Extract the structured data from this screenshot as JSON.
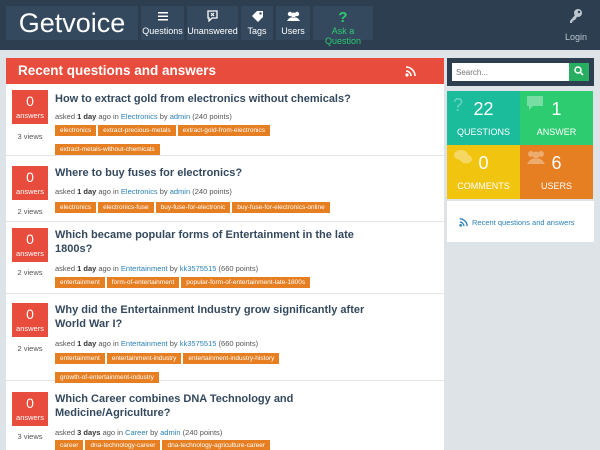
{
  "header": {
    "logo": "Getvoice",
    "nav": [
      {
        "label": "Questions",
        "icon": "list-icon"
      },
      {
        "label": "Unanswered",
        "icon": "unanswered-icon"
      },
      {
        "label": "Tags",
        "icon": "tag-icon"
      },
      {
        "label": "Users",
        "icon": "users-icon"
      },
      {
        "label": "Ask a Question",
        "icon": "question-mark-icon"
      }
    ],
    "login_label": "Login"
  },
  "main": {
    "title": "Recent questions and answers",
    "answers_label": "answers",
    "questions": [
      {
        "answers": "0",
        "views": "3 views",
        "title": "How to extract gold from electronics without chemicals?",
        "asked": "asked",
        "when": "1 day",
        "ago": "ago in",
        "category": "Electronics",
        "by": "by",
        "user": "admin",
        "points": "(240 points)",
        "tags": [
          "electronics",
          "extract-precious-metals",
          "extract-gold-from-electronics",
          "extract-metals-without-chemicals"
        ]
      },
      {
        "answers": "0",
        "views": "2 views",
        "title": "Where to buy fuses for electronics?",
        "asked": "asked",
        "when": "1 day",
        "ago": "ago in",
        "category": "Electronics",
        "by": "by",
        "user": "admin",
        "points": "(240 points)",
        "tags": [
          "electronics",
          "electronics-fuse",
          "buy-fuse-for-electronic",
          "buy-fuse-for-electronics-online"
        ]
      },
      {
        "answers": "0",
        "views": "2 views",
        "title": "Which became popular forms of Entertainment in the late 1800s?",
        "asked": "asked",
        "when": "1 day",
        "ago": "ago in",
        "category": "Entertainment",
        "by": "by",
        "user": "kk3575515",
        "points": "(660 points)",
        "tags": [
          "entertainment",
          "form-of-entertainment",
          "popular-form-of-entertainment-late-1800s"
        ]
      },
      {
        "answers": "0",
        "views": "2 views",
        "title": "Why did the Entertainment Industry grow significantly after World War I?",
        "asked": "asked",
        "when": "1 day",
        "ago": "ago in",
        "category": "Entertainment",
        "by": "by",
        "user": "kk3575515",
        "points": "(660 points)",
        "tags": [
          "entertainment",
          "entertainment-industry",
          "entertainment-industry-history",
          "growth-of-entertainment-industry"
        ]
      },
      {
        "answers": "0",
        "views": "3 views",
        "title": "Which Career combines DNA Technology and Medicine/Agriculture?",
        "asked": "asked",
        "when": "3 days",
        "ago": "ago in",
        "category": "Career",
        "by": "by",
        "user": "admin",
        "points": "(240 points)",
        "tags": [
          "career",
          "dna-technology-career",
          "dna-technology-agriculture-career"
        ]
      }
    ]
  },
  "sidebar": {
    "search_placeholder": "Search...",
    "stats": [
      {
        "number": "22",
        "label": "QUESTIONS",
        "color": "#1abc9c",
        "icon": "question-icon"
      },
      {
        "number": "1",
        "label": "ANSWER",
        "color": "#2ecc71",
        "icon": "answer-bubble-icon"
      },
      {
        "number": "0",
        "label": "COMMENTS",
        "color": "#f1c40f",
        "icon": "comments-icon"
      },
      {
        "number": "6",
        "label": "USERS",
        "color": "#e67e22",
        "icon": "users-icon"
      }
    ],
    "feed_label": "Recent questions and answers"
  },
  "colors": {
    "header": "#2c3e50",
    "accent_red": "#e74c3c",
    "tag_orange": "#e67e22",
    "link_blue": "#2980b9"
  }
}
